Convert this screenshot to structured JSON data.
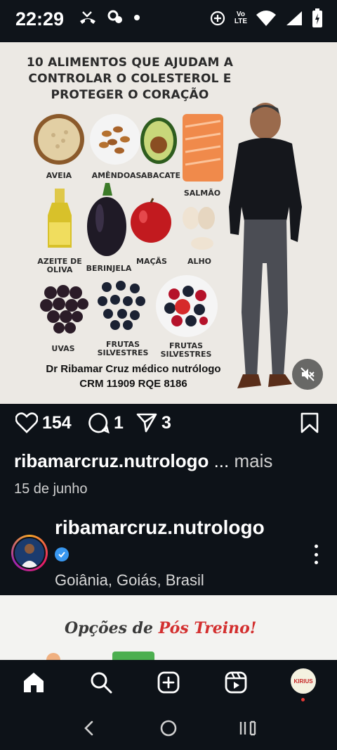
{
  "status_bar": {
    "time": "22:29",
    "lte_top": "Vo",
    "lte_bottom": "LTE",
    "icons": [
      "missed-call-icon",
      "messenger-icon",
      "dot-icon",
      "data-saver-icon",
      "lte-icon",
      "wifi-icon",
      "signal-icon",
      "battery-charging-icon"
    ]
  },
  "post": {
    "image": {
      "title": "10 ALIMENTOS QUE AJUDAM A CONTROLAR O COLESTEROL E PROTEGER O CORAÇÃO",
      "foods": {
        "aveia": "AVEIA",
        "amendoas": "AMÊNDOAS",
        "abacate": "ABACATE",
        "salmao": "SALMÃO",
        "azeite_line1": "AZEITE DE",
        "azeite_line2": "OLIVA",
        "berinjela": "BERINJELA",
        "macas": "MAÇÃS",
        "alho": "ALHO",
        "uvas": "UVAS",
        "frutas1_line1": "FRUTAS",
        "frutas1_line2": "SILVESTRES",
        "frutas2_line1": "FRUTAS",
        "frutas2_line2": "SILVESTRES"
      },
      "credit_line1": "Dr Ribamar Cruz médico nutrólogo",
      "credit_line2": "CRM 11909 RQE 8186"
    },
    "likes": "154",
    "comments": "1",
    "shares": "3",
    "caption_user": "ribamarcruz.nutrologo",
    "caption_ellipsis": " ... ",
    "caption_more": "mais",
    "date": "15 de junho"
  },
  "next_post": {
    "username": "ribamarcruz.nutrologo",
    "location": "Goiânia, Goiás, Brasil",
    "media_title_part1": "Opções de ",
    "media_title_part2": "Pós Treino!"
  },
  "bottom_nav": {
    "items": [
      "home-icon",
      "search-icon",
      "create-icon",
      "reels-icon",
      "profile-avatar"
    ],
    "profile_text": "KIRIUS"
  },
  "colors": {
    "background": "#0d1218",
    "verified": "#3897f0",
    "image_bg": "#ece9e4"
  }
}
